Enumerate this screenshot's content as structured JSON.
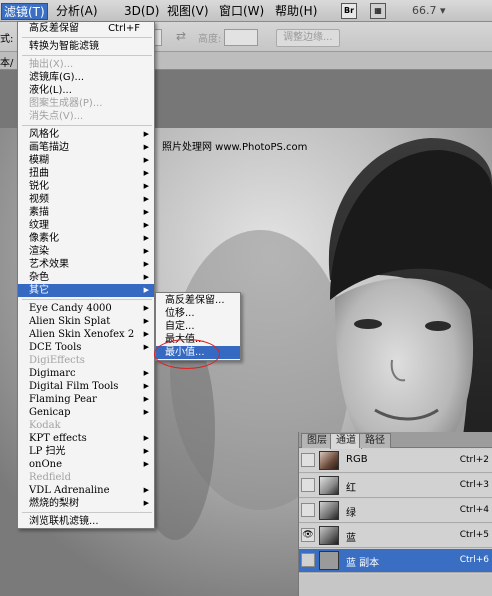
{
  "menubar": {
    "items": [
      {
        "label": "滤镜(T)",
        "active": true
      },
      {
        "label": "分析(A)"
      },
      {
        "label": "3D(D)"
      },
      {
        "label": "视图(V)"
      },
      {
        "label": "窗口(W)"
      },
      {
        "label": "帮助(H)"
      }
    ],
    "br_label": "Br",
    "zoom": "66.7"
  },
  "optbar": {
    "left_label": "式:",
    "height_label": "高度:",
    "refine_edge": "调整边缘..."
  },
  "tabrow": {
    "label": "本/"
  },
  "watermark": "照片处理网 www.PhotoPS.com",
  "filter_menu": {
    "top": [
      {
        "label": "高反差保留",
        "shortcut": "Ctrl+F"
      },
      {
        "label": "转换为智能滤镜"
      }
    ],
    "group2": [
      {
        "label": "抽出(X)...",
        "disabled": true
      },
      {
        "label": "滤镜库(G)..."
      },
      {
        "label": "液化(L)..."
      },
      {
        "label": "图案生成器(P)...",
        "disabled": true
      },
      {
        "label": "消失点(V)...",
        "disabled": true
      }
    ],
    "group3": [
      {
        "label": "风格化"
      },
      {
        "label": "画笔描边"
      },
      {
        "label": "模糊"
      },
      {
        "label": "扭曲"
      },
      {
        "label": "锐化"
      },
      {
        "label": "视频"
      },
      {
        "label": "素描"
      },
      {
        "label": "纹理"
      },
      {
        "label": "像素化"
      },
      {
        "label": "渲染"
      },
      {
        "label": "艺术效果"
      },
      {
        "label": "杂色"
      },
      {
        "label": "其它",
        "highlighted": true
      }
    ],
    "group4": [
      {
        "label": "Eye Candy 4000"
      },
      {
        "label": "Alien Skin Splat"
      },
      {
        "label": "Alien Skin Xenofex 2"
      },
      {
        "label": "DCE Tools"
      },
      {
        "label": "DigiEffects",
        "disabled": true
      },
      {
        "label": "Digimarc"
      },
      {
        "label": "Digital Film Tools"
      },
      {
        "label": "Flaming Pear"
      },
      {
        "label": "Genicap"
      },
      {
        "label": "Kodak",
        "disabled": true
      },
      {
        "label": "KPT effects"
      },
      {
        "label": "LP 扫光"
      },
      {
        "label": "onOne"
      },
      {
        "label": "Redfield",
        "disabled": true
      },
      {
        "label": "VDL Adrenaline"
      },
      {
        "label": "燃烧的梨树"
      }
    ],
    "bottom": [
      {
        "label": "浏览联机滤镜..."
      }
    ]
  },
  "other_submenu": [
    {
      "label": "高反差保留..."
    },
    {
      "label": "位移..."
    },
    {
      "label": "自定..."
    },
    {
      "label": "最大值..."
    },
    {
      "label": "最小值...",
      "highlighted": true
    }
  ],
  "channels_panel": {
    "tabs": [
      "图层",
      "通道",
      "路径"
    ],
    "active_tab": "通道",
    "channels": [
      {
        "name": "RGB",
        "shortcut": "Ctrl+2",
        "visible": false
      },
      {
        "name": "红",
        "shortcut": "Ctrl+3",
        "visible": false
      },
      {
        "name": "绿",
        "shortcut": "Ctrl+4",
        "visible": false
      },
      {
        "name": "蓝",
        "shortcut": "Ctrl+5",
        "visible": true
      },
      {
        "name": "蓝 副本",
        "shortcut": "Ctrl+6",
        "visible": false,
        "selected": true
      }
    ]
  },
  "colors": {
    "accent": "#3569c2",
    "annotation": "#dd2222"
  }
}
